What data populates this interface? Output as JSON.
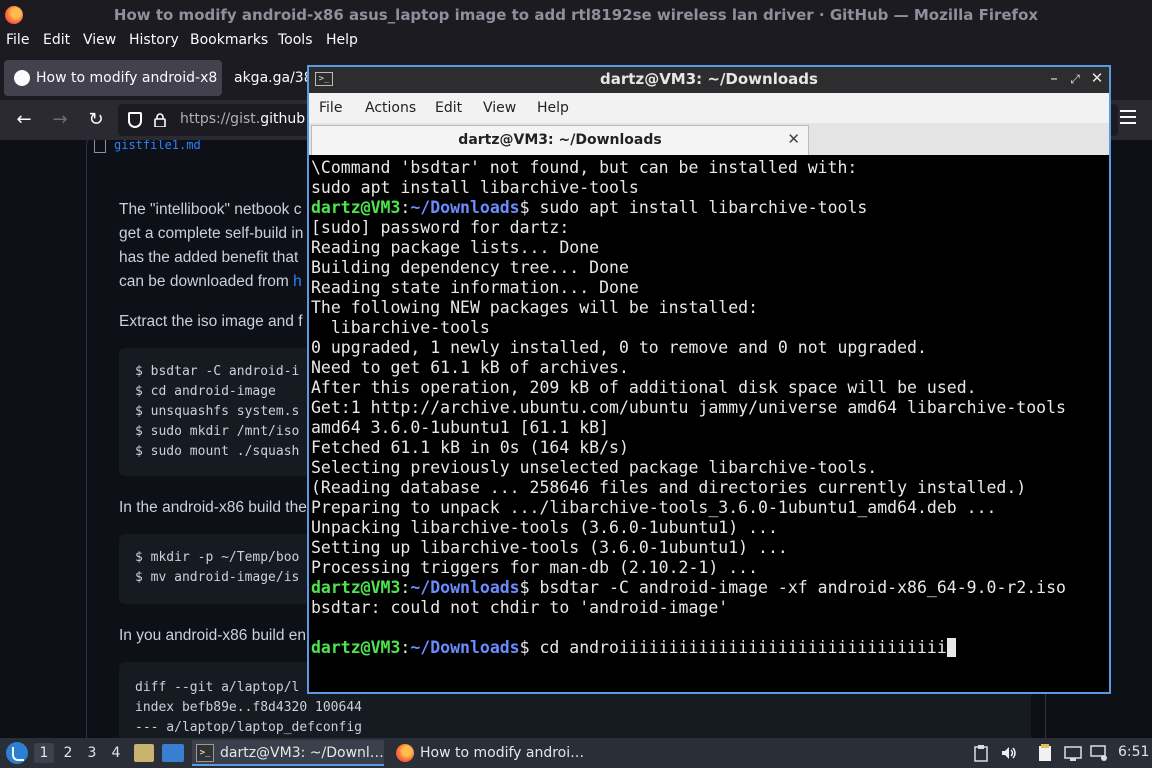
{
  "firefox": {
    "window_title": "How to modify android-x86 asus_laptop image to add rtl8192se wireless lan driver · GitHub — Mozilla Firefox",
    "menu": [
      "File",
      "Edit",
      "View",
      "History",
      "Bookmarks",
      "Tools",
      "Help"
    ],
    "tabs": [
      {
        "label": "How to modify android-x8",
        "active": true,
        "icon": "github-icon"
      },
      {
        "label": "akga.ga/38",
        "active": false,
        "icon": ""
      }
    ],
    "url_prefix": "https://gist.",
    "url_host": "github",
    "page": {
      "file_name": "gistfile1.md",
      "para1": [
        "The \"intellibook\" netbook c",
        "get a complete self-build in",
        "has the added benefit that",
        "can be downloaded from "
      ],
      "para1_link": "h",
      "para2": "Extract the iso image and f",
      "code1": [
        "$ bsdtar -C android-i",
        "$ cd android-image",
        "$ unsquashfs system.s",
        "$ sudo mkdir /mnt/iso",
        "$ sudo mount ./squash"
      ],
      "para3": "In the android-x86 build the",
      "code2": [
        "$ mkdir -p ~/Temp/boo",
        "$ mv android-image/is"
      ],
      "para4": "In you android-x86 build en",
      "code3": [
        "diff --git a/laptop/l",
        "index befb89e..f8d4320 100644",
        "--- a/laptop/laptop_defconfig"
      ]
    }
  },
  "terminal": {
    "title": "dartz@VM3: ~/Downloads",
    "title_icon": ">_",
    "menu": [
      "File",
      "Actions",
      "Edit",
      "View",
      "Help"
    ],
    "tab_label": "dartz@VM3: ~/Downloads",
    "prompt_user": "dartz@VM3",
    "prompt_path": "~/Downloads",
    "lines": [
      {
        "type": "out",
        "text": "\\Command 'bsdtar' not found, but can be installed with:"
      },
      {
        "type": "out",
        "text": "sudo apt install libarchive-tools"
      },
      {
        "type": "cmd",
        "text": "$ sudo apt install libarchive-tools"
      },
      {
        "type": "out",
        "text": "[sudo] password for dartz:"
      },
      {
        "type": "out",
        "text": "Reading package lists... Done"
      },
      {
        "type": "out",
        "text": "Building dependency tree... Done"
      },
      {
        "type": "out",
        "text": "Reading state information... Done"
      },
      {
        "type": "out",
        "text": "The following NEW packages will be installed:"
      },
      {
        "type": "out",
        "text": "  libarchive-tools"
      },
      {
        "type": "out",
        "text": "0 upgraded, 1 newly installed, 0 to remove and 0 not upgraded."
      },
      {
        "type": "out",
        "text": "Need to get 61.1 kB of archives."
      },
      {
        "type": "out",
        "text": "After this operation, 209 kB of additional disk space will be used."
      },
      {
        "type": "out",
        "text": "Get:1 http://archive.ubuntu.com/ubuntu jammy/universe amd64 libarchive-tools"
      },
      {
        "type": "out",
        "text": "amd64 3.6.0-1ubuntu1 [61.1 kB]"
      },
      {
        "type": "out",
        "text": "Fetched 61.1 kB in 0s (164 kB/s)"
      },
      {
        "type": "out",
        "text": "Selecting previously unselected package libarchive-tools."
      },
      {
        "type": "out",
        "text": "(Reading database ... 258646 files and directories currently installed.)"
      },
      {
        "type": "out",
        "text": "Preparing to unpack .../libarchive-tools_3.6.0-1ubuntu1_amd64.deb ..."
      },
      {
        "type": "out",
        "text": "Unpacking libarchive-tools (3.6.0-1ubuntu1) ..."
      },
      {
        "type": "out",
        "text": "Setting up libarchive-tools (3.6.0-1ubuntu1) ..."
      },
      {
        "type": "out",
        "text": "Processing triggers for man-db (2.10.2-1) ..."
      },
      {
        "type": "cmd",
        "text": "$ bsdtar -C android-image -xf android-x86_64-9.0-r2.iso"
      },
      {
        "type": "out",
        "text": "bsdtar: could not chdir to 'android-image'"
      },
      {
        "type": "out",
        "text": ""
      },
      {
        "type": "cmd",
        "text": "$ cd androiiiiiiiiiiiiiiiiiiiiiiiiiiiiiiiii",
        "cursor": true
      }
    ]
  },
  "taskbar": {
    "workspaces": [
      "1",
      "2",
      "3",
      "4"
    ],
    "tasks": [
      {
        "label": "dartz@VM3: ~/Downl…",
        "active": true,
        "icon": "terminal-icon"
      },
      {
        "label": "How to modify androi…",
        "active": false,
        "icon": "firefox-icon"
      }
    ],
    "clock": "6:51"
  }
}
